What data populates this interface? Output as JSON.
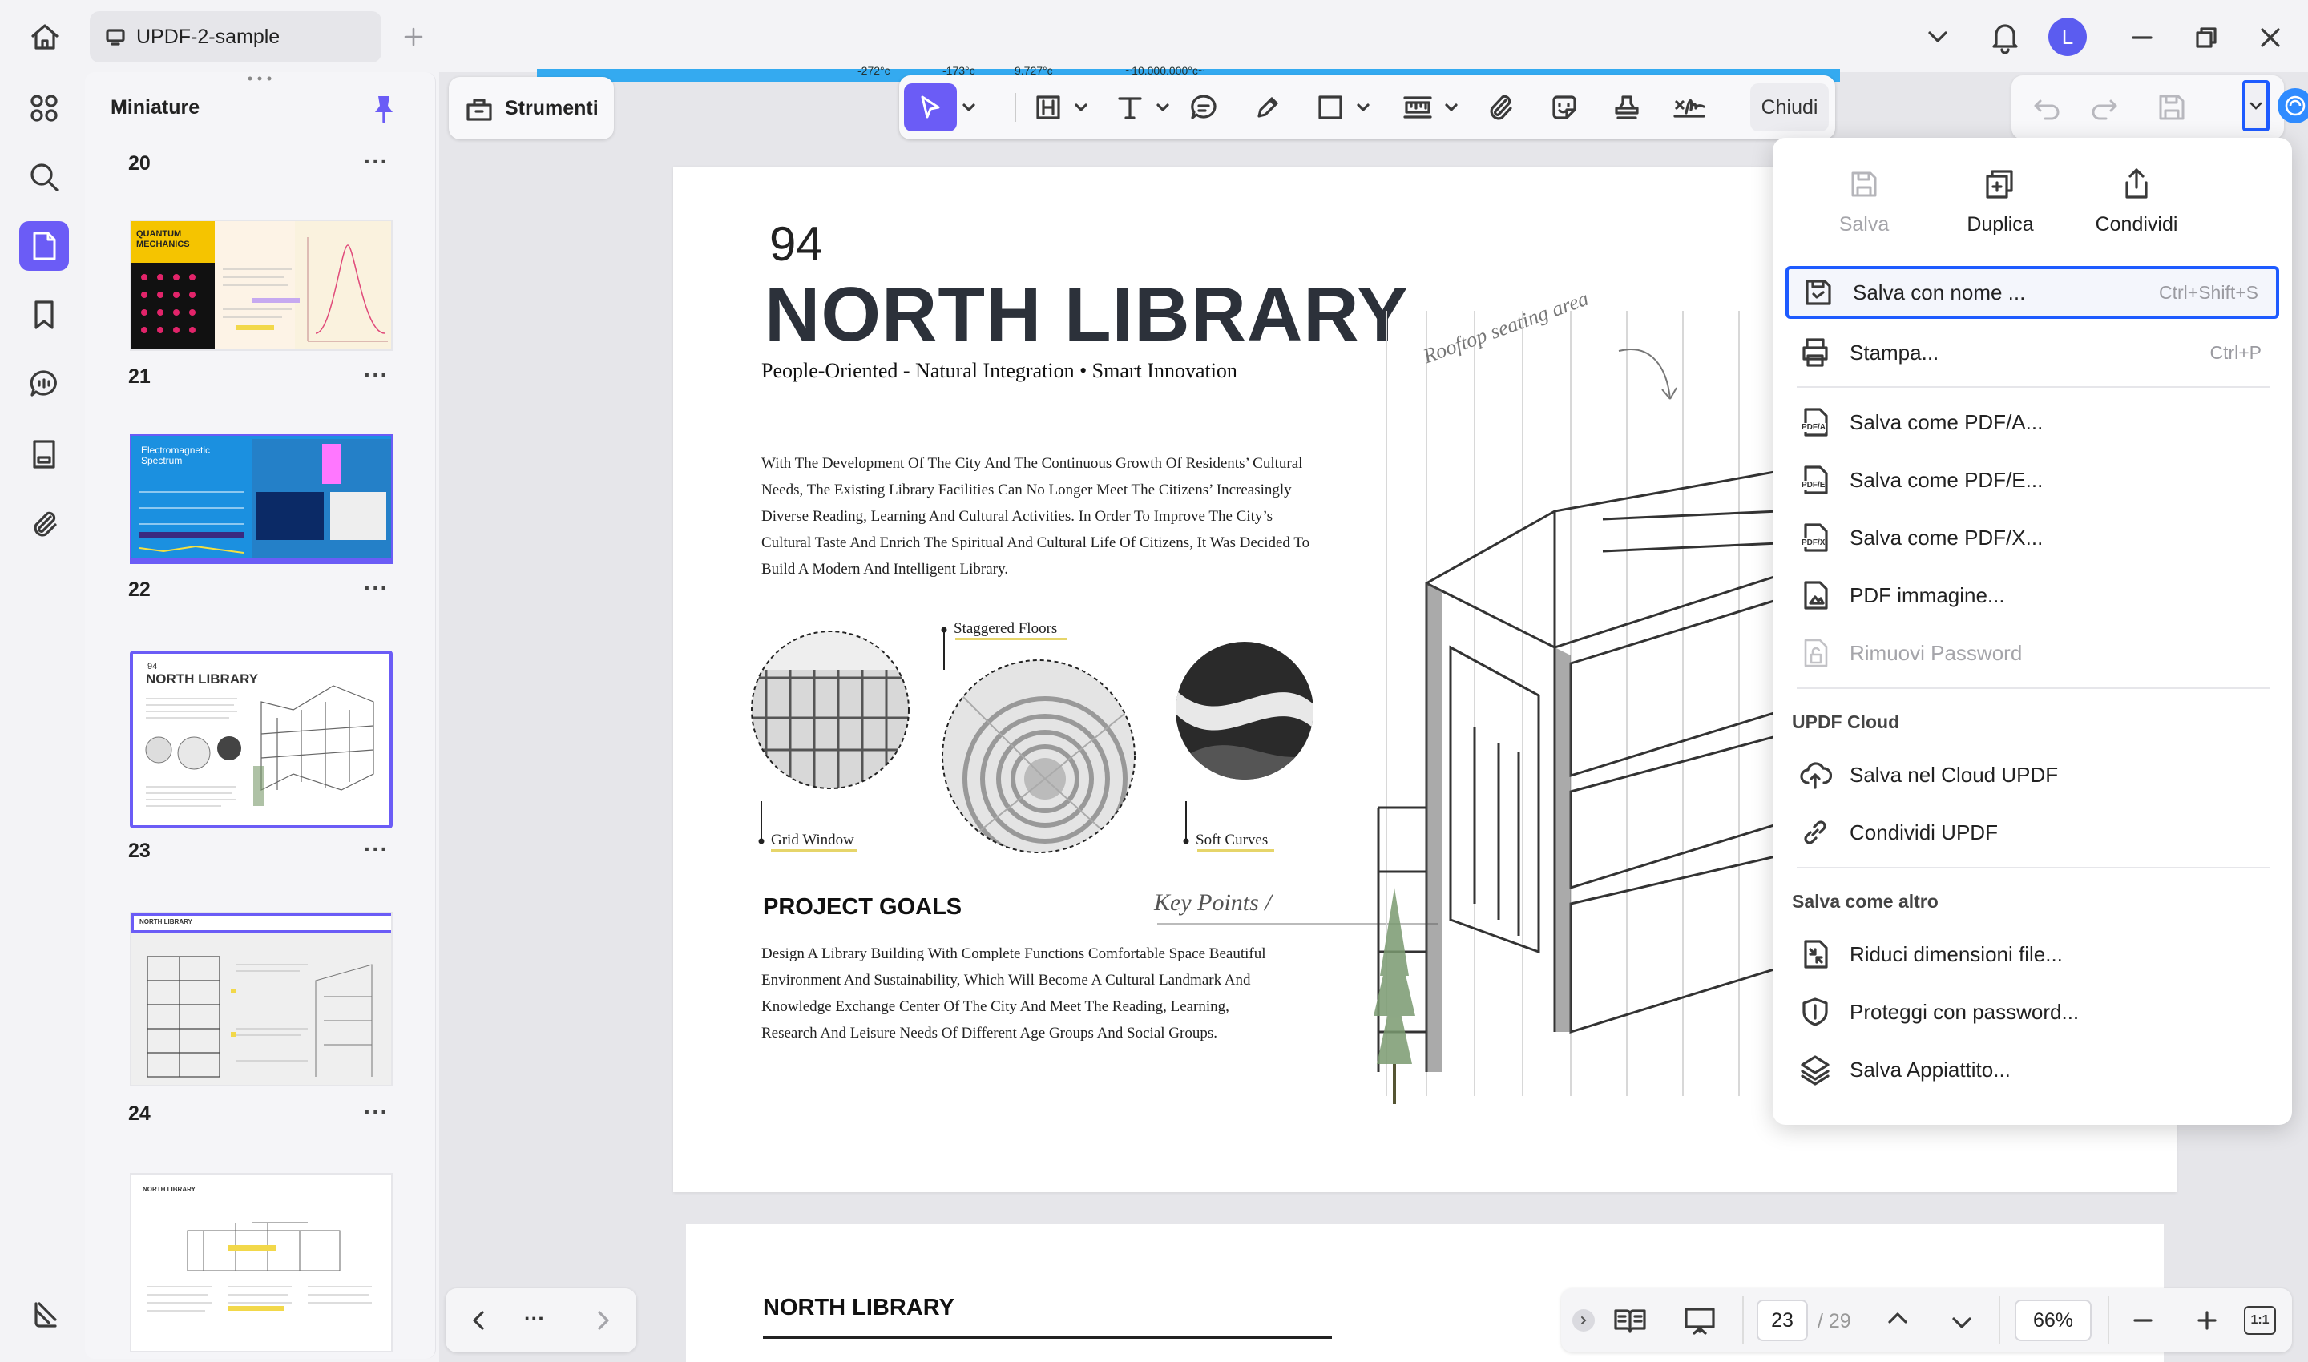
{
  "window": {
    "tab_title": "UPDF-2-sample",
    "avatar_letter": "L"
  },
  "sidebar": {
    "title": "Miniature",
    "thumbnails": [
      {
        "label": "20"
      },
      {
        "label": "21"
      },
      {
        "label": "22"
      },
      {
        "label": "23"
      },
      {
        "label": "24"
      }
    ],
    "more_label": "···",
    "thumb21_text": "QUANTUM MECHANICS",
    "thumb22_text": "Electromagnetic Spectrum",
    "thumb23_num": "94",
    "thumb23_title": "NORTH LIBRARY",
    "thumb24_title": "NORTH LIBRARY",
    "thumb25_title": "NORTH LIBRARY"
  },
  "toolbar": {
    "tools_label": "Strumenti",
    "close_label": "Chiudi",
    "ruler_labels": [
      "-272°c",
      "-173°c",
      "9,727°c",
      "~10,000,000°c~"
    ]
  },
  "page": {
    "number": "94",
    "title": "NORTH LIBRARY",
    "subtitle": "People-Oriented - Natural Integration • Smart Innovation",
    "body": "With The Development Of The City And The Continuous Growth Of Residents’ Cultural Needs, The Existing Library Facilities Can No Longer Meet The Citizens’ Increasingly Diverse Reading, Learning And Cultural Activities. In Order To Improve The City’s Cultural Taste And Enrich The Spiritual And Cultural Life Of Citizens, It Was Decided To Build A Modern And Intelligent Library.",
    "annotation": "Rooftop seating area",
    "label_staggered": "Staggered Floors",
    "label_grid": "Grid Window",
    "label_soft": "Soft Curves",
    "goals_title": "PROJECT GOALS",
    "key_points": "Key Points /",
    "goals_body": "Design A Library Building With Complete Functions Comfortable Space Beautiful Environment And Sustainability, Which Will Become A Cultural Landmark And Knowledge Exchange Center Of The City And Meet The Reading, Learning, Research And Leisure Needs Of Different Age Groups And Social Groups.",
    "next_title": "NORTH LIBRARY"
  },
  "menu": {
    "quick": {
      "save": "Salva",
      "duplicate": "Duplica",
      "share": "Condividi"
    },
    "save_as": {
      "label": "Salva con nome ...",
      "shortcut": "Ctrl+Shift+S"
    },
    "print": {
      "label": "Stampa...",
      "shortcut": "Ctrl+P"
    },
    "pdfa": "Salva come PDF/A...",
    "pdfe": "Salva come PDF/E...",
    "pdfx": "Salva come PDF/X...",
    "pdf_image": "PDF immagine...",
    "remove_password": "Rimuovi Password",
    "cloud_section": "UPDF Cloud",
    "cloud_save": "Salva nel Cloud UPDF",
    "cloud_share": "Condividi UPDF",
    "other_section": "Salva come altro",
    "reduce": "Riduci dimensioni file...",
    "protect": "Proteggi con password...",
    "flatten": "Salva Appiattito...",
    "badges": {
      "pdfa": "PDF/A",
      "pdfe": "PDF/E",
      "pdfx": "PDF/X"
    }
  },
  "bottom": {
    "nav_more": "···",
    "page_current": "23",
    "page_total": "/ 29",
    "zoom": "66%",
    "fit_label": "1:1"
  },
  "colors": {
    "accent": "#6b5cf6",
    "highlight": "#1e5bff",
    "strip": "#34aaf0"
  }
}
